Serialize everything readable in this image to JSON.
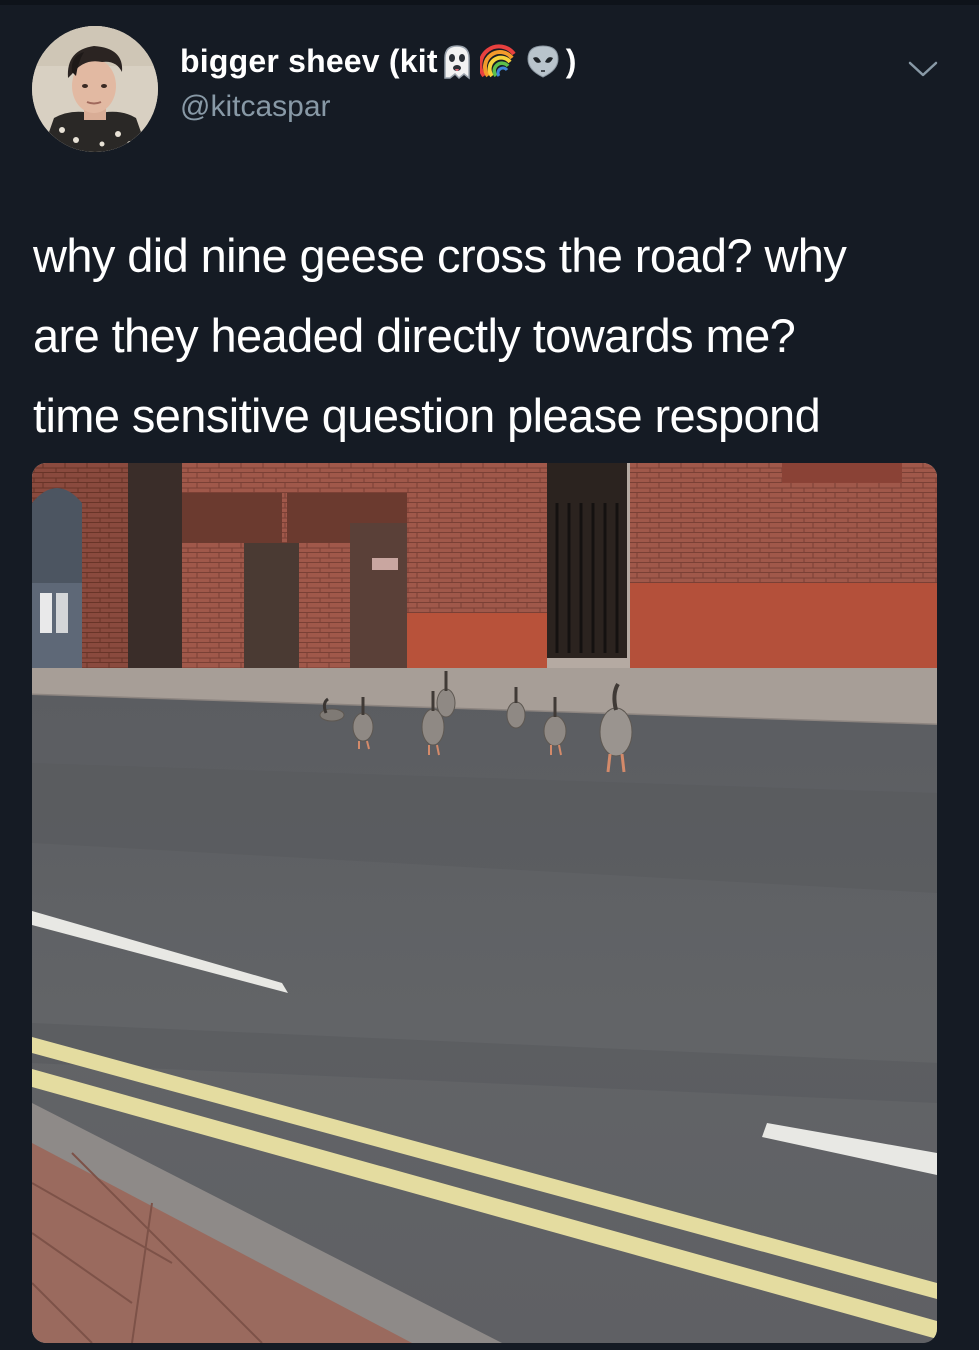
{
  "tweet": {
    "display_name": "bigger sheev (kit",
    "display_name_end": ")",
    "name_emojis": [
      "ghost-icon",
      "rainbow-icon",
      "alien-icon"
    ],
    "handle": "@kitcaspar",
    "text_lines": [
      "why did nine geese cross the road? why",
      "are they headed directly towards me?",
      "time sensitive question please respond"
    ]
  },
  "colors": {
    "background": "#151b24",
    "handle": "#8899a6",
    "text": "#ffffff"
  }
}
